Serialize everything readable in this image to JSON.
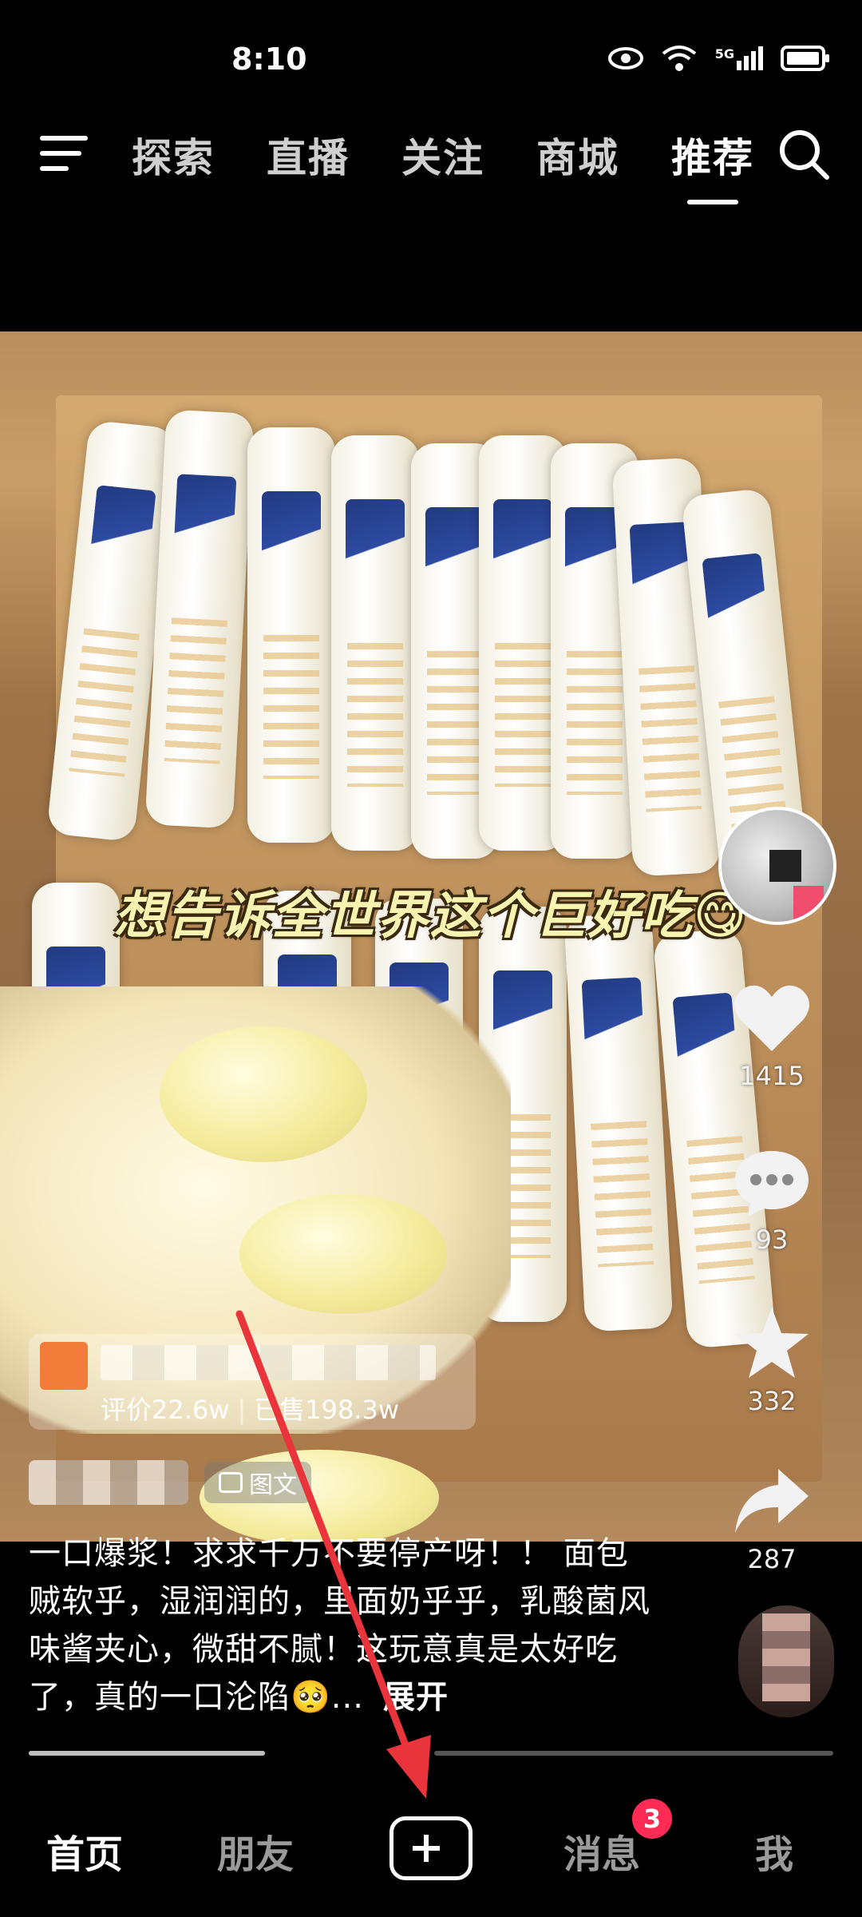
{
  "status_bar": {
    "time": "8:10",
    "network": "5G"
  },
  "top_nav": {
    "tabs": [
      {
        "label": "探索"
      },
      {
        "label": "直播"
      },
      {
        "label": "关注"
      },
      {
        "label": "商城"
      },
      {
        "label": "推荐",
        "active": true
      }
    ]
  },
  "video": {
    "overlay_caption": "想告诉全世界这个巨好吃😋"
  },
  "actions": {
    "like_count": "1415",
    "comment_count": "93",
    "favorite_count": "332",
    "share_count": "287"
  },
  "product": {
    "reviews": "评价22.6w",
    "sold": "已售198.3w"
  },
  "author": {
    "tag_label": "图文"
  },
  "description": {
    "text": "一口爆浆！求求千万不要停产呀！！ 面包贼软乎，湿润润的，里面奶乎乎，乳酸菌风味酱夹心，微甜不腻！这玩意真是太好吃了，真的一口沦陷🥺...",
    "expand_label": "展开"
  },
  "progress": {
    "fraction": 0.29
  },
  "bottom_nav": {
    "items": [
      {
        "label": "首页",
        "active": true
      },
      {
        "label": "朋友"
      },
      {
        "label": "消息",
        "badge": "3"
      },
      {
        "label": "我"
      }
    ]
  },
  "colors": {
    "accent_red": "#ff2b54",
    "annotation_arrow": "#e8343a"
  }
}
